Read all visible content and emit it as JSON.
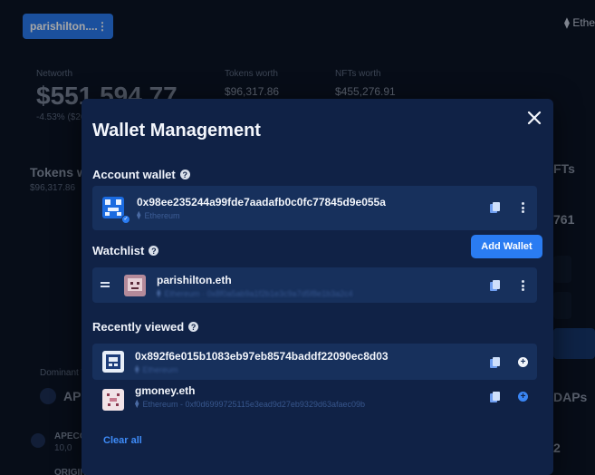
{
  "header": {
    "wallet_chip_name": "parishilton....",
    "chain_label": "Ethe"
  },
  "background": {
    "networth_label": "Networth",
    "networth_value": "$551,594.77",
    "networth_change": "-4.53% ($26",
    "tokens_worth_label": "Tokens worth",
    "tokens_worth_value": "$96,317.86",
    "nfts_worth_label": "NFTs worth",
    "nfts_worth_value": "$455,276.91",
    "tokens_title": "Tokens w",
    "tokens_sub": "$96,317.86",
    "nfts_title": "FTs",
    "nfts_count": "761",
    "dapps_title": "DAPs",
    "apecoin_short": "AP",
    "apecoin_row": "APECO",
    "apecoin_amount": "10,0",
    "origin_row": "ORIGIN",
    "dominant_label": "Dominant T",
    "right_num": "2"
  },
  "modal": {
    "title": "Wallet Management",
    "account_wallet": {
      "label": "Account wallet",
      "address": "0x98ee235244a99fde7aadafb0c0fc77845d9e055a",
      "chain": "Ethereum"
    },
    "add_wallet_label": "Add Wallet",
    "watchlist": {
      "label": "Watchlist",
      "items": [
        {
          "name": "parishilton.eth",
          "sub": "Ethereum · 0x8f0a5ab9a1f2b1e3c9a7d5f8e1b3a2c4"
        }
      ]
    },
    "recently_viewed": {
      "label": "Recently viewed",
      "items": [
        {
          "name": "0x892f6e015b1083eb97eb8574baddf22090ec8d03",
          "sub": "Ethereum"
        },
        {
          "name": "gmoney.eth",
          "sub": "Ethereum - 0xf0d6999725115e3ead9d27eb9329d63afaec09b"
        }
      ]
    },
    "clear_all_label": "Clear all"
  },
  "colors": {
    "accent": "#2a7cf2",
    "modal_bg": "#102246",
    "row_bg": "#17305c",
    "link": "#3e8bf7"
  }
}
